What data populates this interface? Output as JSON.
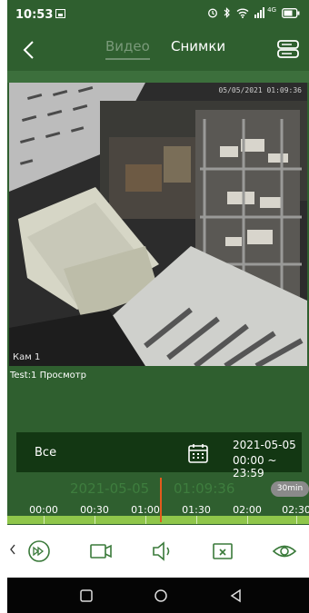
{
  "status_bar": {
    "time": "10:53",
    "icons": [
      "photo-icon",
      "alarm-icon",
      "bluetooth-icon",
      "wifi-icon",
      "signal-icon",
      "battery-icon"
    ],
    "network_badge": "4G"
  },
  "header": {
    "back_icon": "chevron-left-icon",
    "tabs": [
      {
        "label": "Видео",
        "active": false
      },
      {
        "label": "Снимки",
        "active": true
      }
    ],
    "menu_icon": "storage-list-icon"
  },
  "video": {
    "timestamp": "05/05/2021 01:09:36",
    "camera_label": "Кам 1"
  },
  "info_line": "Test:1  Просмотр",
  "filter": {
    "label": "Все",
    "calendar_icon": "calendar-icon",
    "date": "2021-05-05",
    "time_range": "00:00 ~ 23:59"
  },
  "timeline": {
    "current_date": "2021-05-05",
    "current_time": "01:09:36",
    "zoom": "30min",
    "ticks": [
      "00:00",
      "00:30",
      "01:00",
      "01:30",
      "02:00",
      "02:30"
    ],
    "cursor_color": "#e35a1d",
    "recording_color": "#8fc64a"
  },
  "toolbar": {
    "items": [
      {
        "icon": "fast-forward-icon"
      },
      {
        "icon": "video-record-icon"
      },
      {
        "icon": "speaker-icon"
      },
      {
        "icon": "close-stream-icon"
      },
      {
        "icon": "eye-icon"
      }
    ]
  },
  "system_nav": {
    "items": [
      "recent-apps-icon",
      "home-icon",
      "back-icon"
    ]
  },
  "colors": {
    "app_background": "#2f5f2f",
    "filter_card": "#133713",
    "accent_text": "#3e7d3e"
  }
}
